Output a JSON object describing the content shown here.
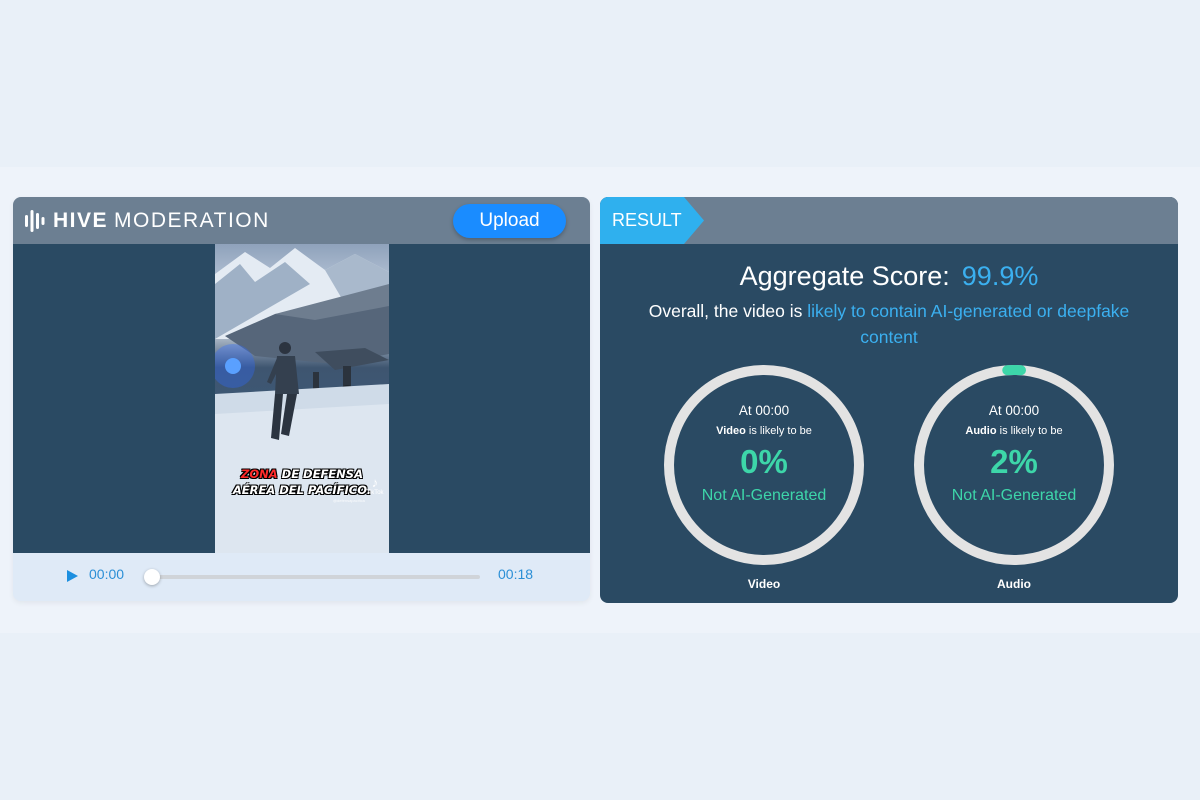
{
  "app": {
    "logo_bold": "HIVE",
    "logo_light": "MODERATION",
    "upload_label": "Upload"
  },
  "video": {
    "caption_red": "ZONA",
    "caption_line1_rest": " DE DEFENSA",
    "caption_line2": "AÉREA DEL PACÍFICO.",
    "platform_badge": "TikTok",
    "watermark": "@defensapacifica"
  },
  "player": {
    "current_time": "00:00",
    "duration": "00:18",
    "progress": 0
  },
  "result": {
    "tag": "RESULT",
    "aggregate_label": "Aggregate Score:",
    "aggregate_value": "99.9%",
    "overall_prefix": "Overall, the video is ",
    "overall_highlight": "likely to contain AI-generated or deepfake content",
    "gauges": [
      {
        "at_label": "At 00:00",
        "kind": "Video",
        "is_likely": "is likely to be",
        "percent_text": "0%",
        "percent": 0,
        "verdict": "Not AI-Generated",
        "caption": "Video"
      },
      {
        "at_label": "At 00:00",
        "kind": "Audio",
        "is_likely": "is likely to be",
        "percent_text": "2%",
        "percent": 2,
        "verdict": "Not AI-Generated",
        "caption": "Audio"
      }
    ]
  },
  "colors": {
    "accent_blue": "#1a8cff",
    "highlight_blue": "#3bb0f0",
    "score_green": "#3dd6a9",
    "panel_dark": "#2a4a63",
    "header_gray": "#6c7f92"
  }
}
